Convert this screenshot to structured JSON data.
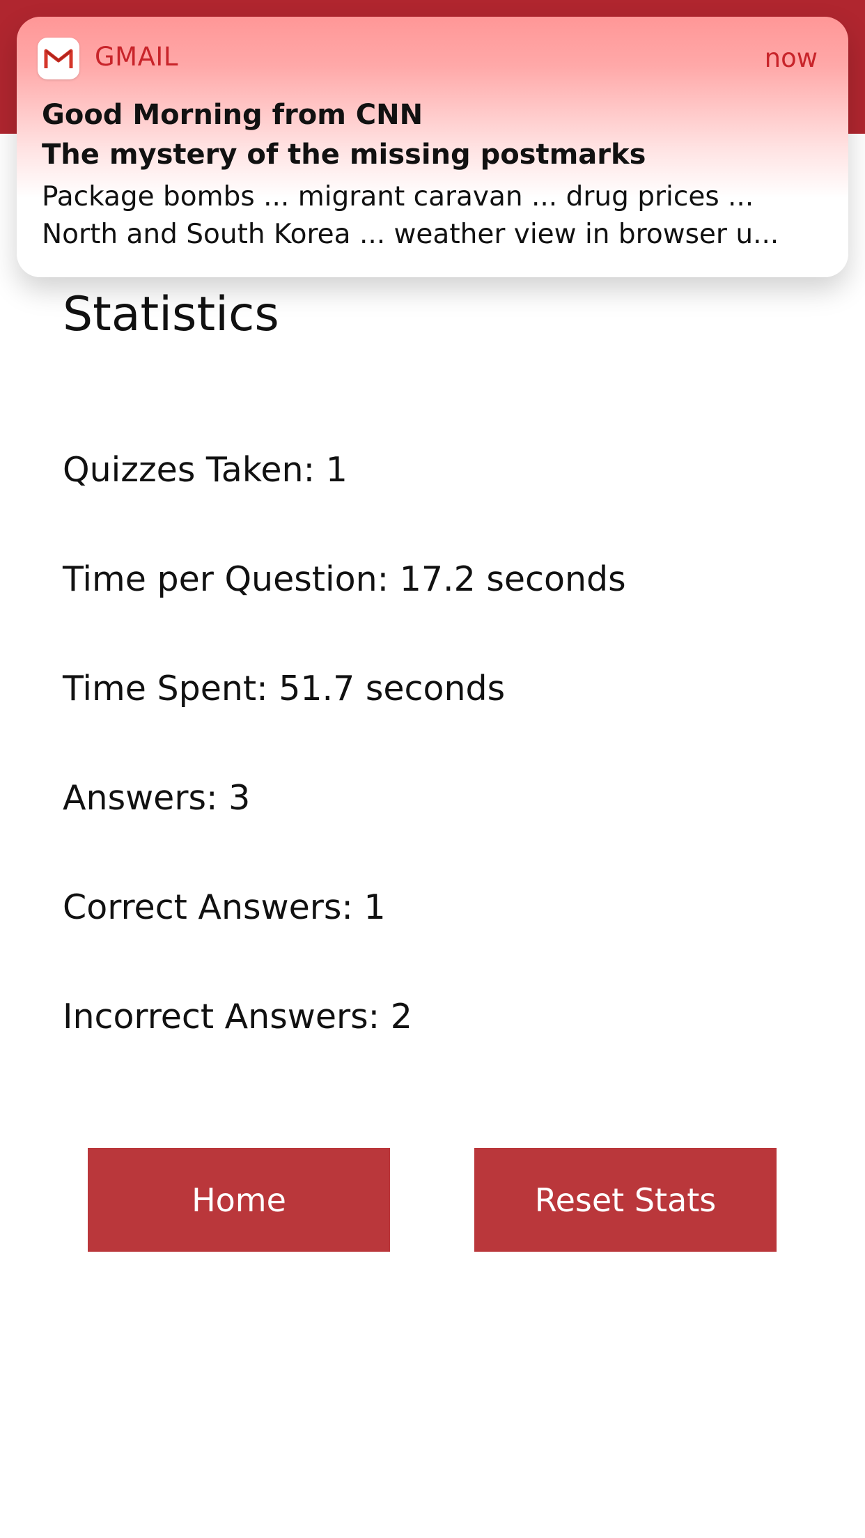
{
  "notification": {
    "app_name": "GMAIL",
    "time": "now",
    "title": "Good Morning from CNN",
    "subtitle": "The mystery of the missing postmarks",
    "body_line1": "Package bombs ... migrant caravan ... drug prices ...",
    "body_line2": "North and South Korea ... weather view in browser u...",
    "icon": "gmail-icon"
  },
  "colors": {
    "header_red": "#b0262f",
    "button_red": "#ba373b",
    "notification_accent": "#c8242a"
  },
  "page": {
    "title": "Statistics"
  },
  "stats": [
    {
      "label": "Quizzes Taken: 1"
    },
    {
      "label": "Time per Question: 17.2 seconds"
    },
    {
      "label": "Time Spent: 51.7 seconds"
    },
    {
      "label": "Answers: 3"
    },
    {
      "label": "Correct Answers: 1"
    },
    {
      "label": "Incorrect Answers: 2"
    }
  ],
  "buttons": {
    "home_label": "Home",
    "reset_label": "Reset Stats"
  }
}
